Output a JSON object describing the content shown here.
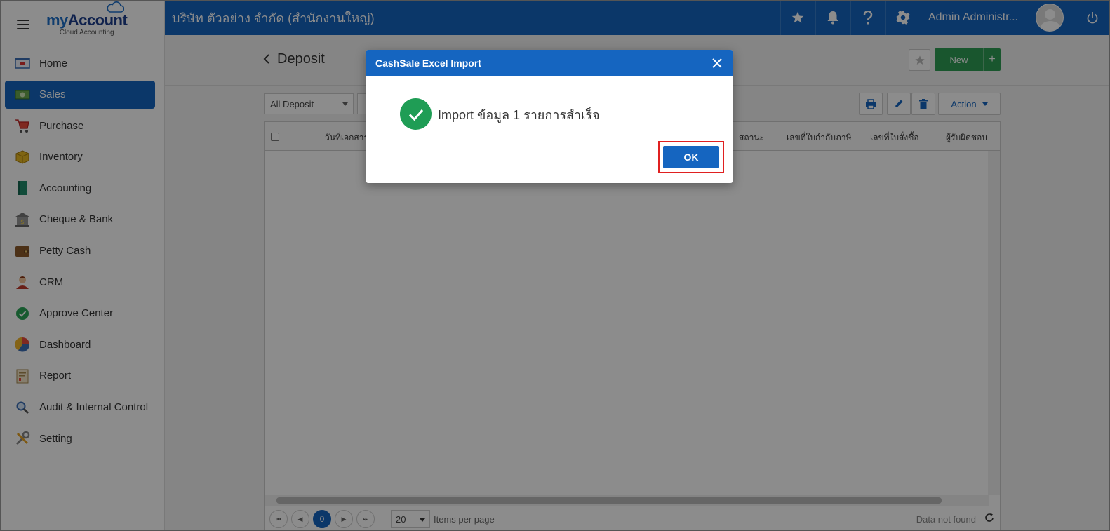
{
  "sidebar": {
    "brand_prefix": "my",
    "brand_main": "Account",
    "brand_sub": "Cloud Accounting",
    "items": [
      {
        "label": "Home",
        "icon": "home-icon",
        "active": false
      },
      {
        "label": "Sales",
        "icon": "sales-money-icon",
        "active": true
      },
      {
        "label": "Purchase",
        "icon": "cart-icon",
        "active": false
      },
      {
        "label": "Inventory",
        "icon": "box-icon",
        "active": false
      },
      {
        "label": "Accounting",
        "icon": "book-icon",
        "active": false
      },
      {
        "label": "Cheque & Bank",
        "icon": "bank-icon",
        "active": false
      },
      {
        "label": "Petty Cash",
        "icon": "wallet-icon",
        "active": false
      },
      {
        "label": "CRM",
        "icon": "crm-person-icon",
        "active": false
      },
      {
        "label": "Approve Center",
        "icon": "check-circle-icon",
        "active": false
      },
      {
        "label": "Dashboard",
        "icon": "pie-chart-icon",
        "active": false
      },
      {
        "label": "Report",
        "icon": "report-icon",
        "active": false
      },
      {
        "label": "Audit & Internal Control",
        "icon": "magnifier-icon",
        "active": false
      },
      {
        "label": "Setting",
        "icon": "tools-icon",
        "active": false
      }
    ]
  },
  "topbar": {
    "company": "บริษัท ตัวอย่าง จำกัด (สำนักงานใหญ่)",
    "user": "Admin Administr..."
  },
  "page": {
    "title": "Deposit",
    "new_label": "New",
    "new_plus": "+",
    "filter_value": "All Deposit",
    "action_label": "Action"
  },
  "grid": {
    "columns": [
      "วันที่เอกสาร",
      "สถานะ",
      "เลขที่ใบกำกับภาษี",
      "เลขที่ใบสั่งซื้อ",
      "ผู้รับผิดชอบ"
    ],
    "page_current": "0",
    "page_size": "20",
    "items_per_page": "Items per page",
    "no_data": "Data not found"
  },
  "modal": {
    "title": "CashSale Excel Import",
    "message": "Import ข้อมูล 1 รายการสำเร็จ",
    "ok_label": "OK"
  },
  "colors": {
    "primary": "#1565c0",
    "success": "#1f9d55",
    "new_button": "#2e9d54",
    "highlight": "#e02020"
  }
}
